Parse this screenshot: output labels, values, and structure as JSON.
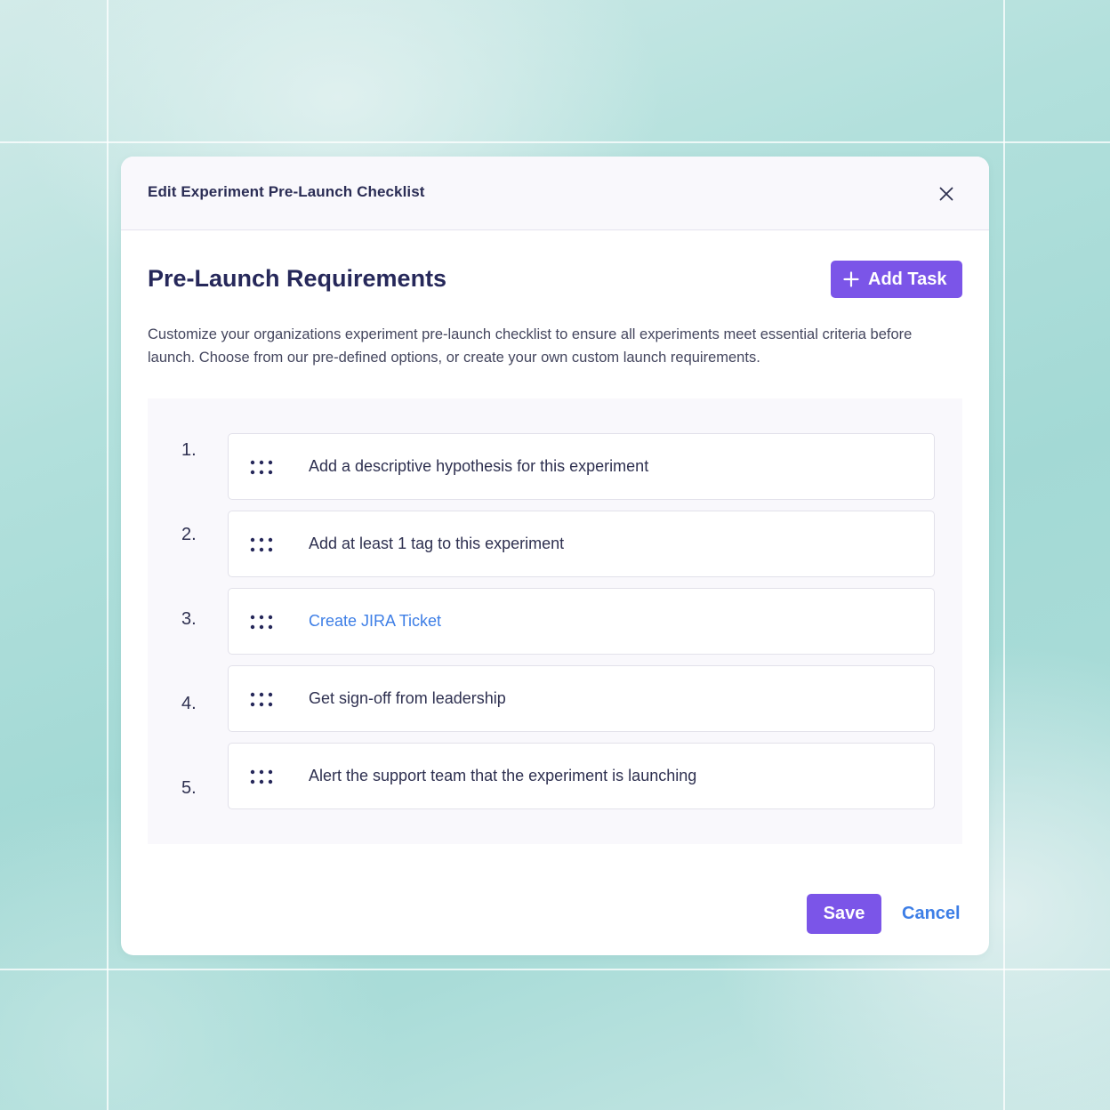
{
  "modal": {
    "title": "Edit Experiment Pre-Launch Checklist",
    "close_icon": "close-icon"
  },
  "section": {
    "title": "Pre-Launch Requirements",
    "add_task_label": "Add Task",
    "add_task_icon": "plus-icon",
    "description": "Customize your organizations experiment pre-launch checklist to ensure all experiments meet essential criteria before launch. Choose from our pre-defined options, or create your own custom launch requirements."
  },
  "tasks": [
    {
      "number": "1.",
      "label": "Add a descriptive hypothesis for this experiment",
      "is_link": false
    },
    {
      "number": "2.",
      "label": "Add at least 1 tag to this experiment",
      "is_link": false
    },
    {
      "number": "3.",
      "label": "Create JIRA Ticket",
      "is_link": true
    },
    {
      "number": "4.",
      "label": "Get sign-off from leadership",
      "is_link": false
    },
    {
      "number": "5.",
      "label": "Alert the support team that the experiment is launching",
      "is_link": false
    }
  ],
  "footer": {
    "save_label": "Save",
    "cancel_label": "Cancel"
  },
  "colors": {
    "accent": "#7b55e8",
    "link": "#3d7ee6",
    "heading": "#26285a",
    "background": "#a3d9d5"
  }
}
